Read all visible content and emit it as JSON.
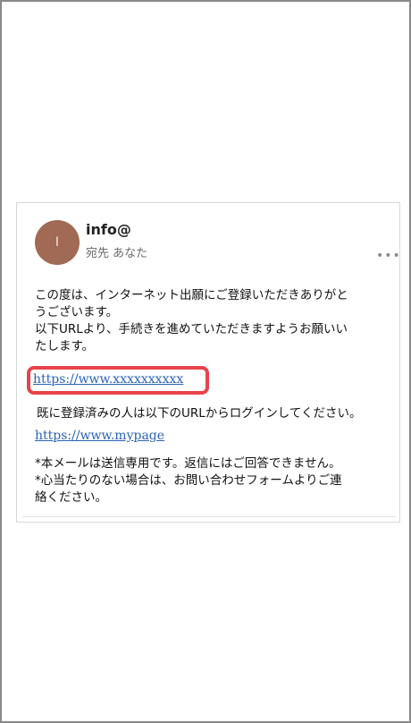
{
  "email": {
    "avatar_letter": "I",
    "sender": "info@",
    "recipient": "宛先 あなた",
    "more_icon": "more-horizontal-icon",
    "body_lines": [
      "この度は、インターネット出願にご登録いただきありがと",
      "うございます。",
      "以下URLより、手続きを進めていただきますようお願いい",
      "たします。"
    ],
    "primary_link": "https://www.xxxxxxxxxx",
    "after_text": "既に登録済みの人は以下のURLからログインしてください。",
    "secondary_link": "https://www.mypage",
    "notes": [
      "*本メールは送信専用です。返信にはご回答できません。",
      "*心当たりのない場合は、お問い合わせフォームよりご連",
      "絡ください。"
    ]
  },
  "colors": {
    "avatar": "#a06a55",
    "link": "#2a63b6",
    "highlight": "#e8434a"
  }
}
